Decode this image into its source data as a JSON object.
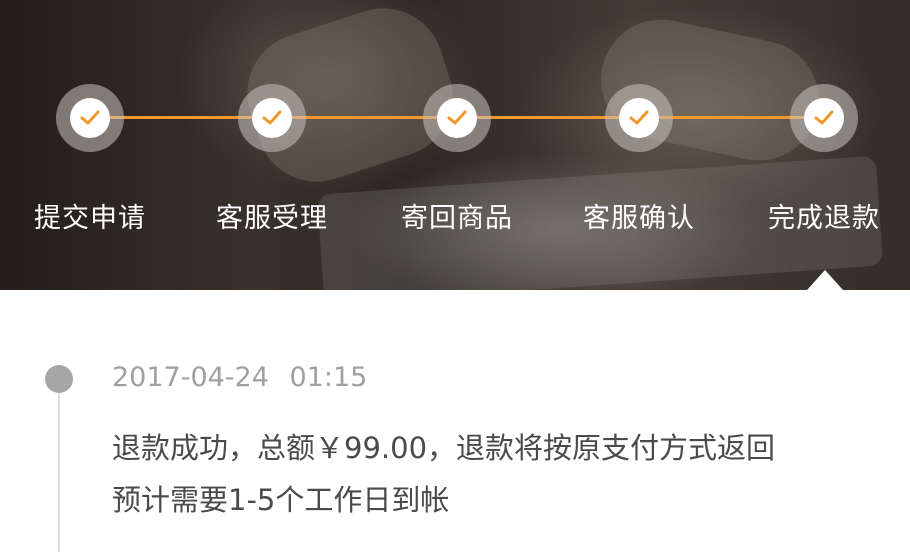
{
  "progress": {
    "accent_color": "#f0982e",
    "steps": [
      {
        "label": "提交申请",
        "status": "done",
        "icon": "check-icon"
      },
      {
        "label": "客服受理",
        "status": "done",
        "icon": "check-icon"
      },
      {
        "label": "寄回商品",
        "status": "done",
        "icon": "check-icon"
      },
      {
        "label": "客服确认",
        "status": "done",
        "icon": "check-icon"
      },
      {
        "label": "完成退款",
        "status": "done",
        "icon": "check-icon"
      }
    ]
  },
  "timeline": {
    "entries": [
      {
        "timestamp": "2017-04-24 01:15",
        "line1": "退款成功，总额￥99.00，退款将按原支付方式返回",
        "line2": "预计需要1-5个工作日到帐"
      }
    ]
  }
}
